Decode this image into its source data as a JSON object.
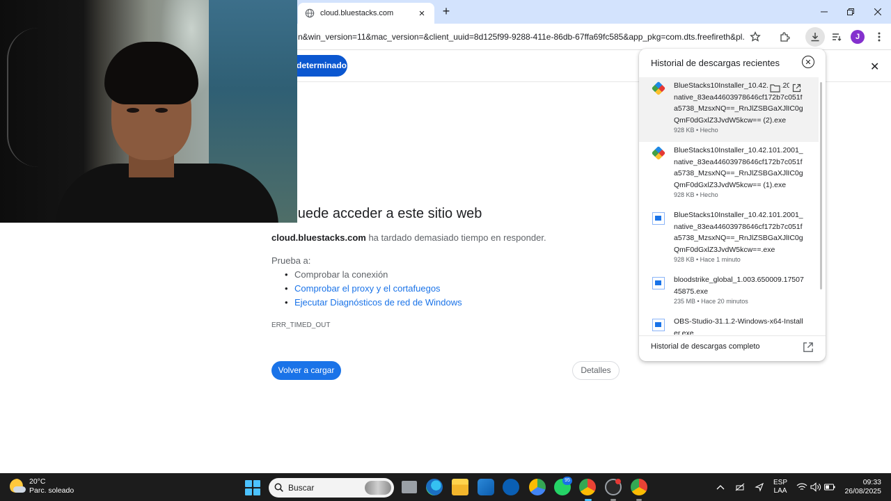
{
  "browser": {
    "tab_title": "cloud.bluestacks.com",
    "url": "n&win_version=11&mac_version=&client_uuid=8d125f99-9288-411e-86db-67ffa69fc585&app_pkg=com.dts.freefireth&pl...",
    "avatar_letter": "J",
    "infobar_button": "determinado"
  },
  "error_page": {
    "title": "se puede acceder a este sitio web",
    "host": "cloud.bluestacks.com",
    "description": " ha tardado demasiado tiempo en responder.",
    "try_label": "Prueba a:",
    "suggestions": [
      "Comprobar la conexión",
      "Comprobar el proxy y el cortafuegos",
      "Ejecutar Diagnósticos de red de Windows"
    ],
    "code": "ERR_TIMED_OUT",
    "reload_label": "Volver a cargar",
    "details_label": "Detalles"
  },
  "downloads": {
    "title": "Historial de descargas recientes",
    "footer": "Historial de descargas completo",
    "items": [
      {
        "name": "BlueStacks10Installer_10.42.101.2001_native_83ea44603978646cf172b7c051fa5738_MzsxNQ==_RnJlZSBGaXJlIC0gQmF0dGxlZ3JvdW5kcw== (2).exe",
        "meta": "928 KB • Hecho",
        "icon": "bluestacks-icon"
      },
      {
        "name": "BlueStacks10Installer_10.42.101.2001_native_83ea44603978646cf172b7c051fa5738_MzsxNQ==_RnJlZSBGaXJlIC0gQmF0dGxlZ3JvdW5kcw== (1).exe",
        "meta": "928 KB • Hecho",
        "icon": "bluestacks-icon"
      },
      {
        "name": "BlueStacks10Installer_10.42.101.2001_native_83ea44603978646cf172b7c051fa5738_MzsxNQ==_RnJlZSBGaXJlIC0gQmF0dGxlZ3JvdW5kcw==.exe",
        "meta": "928 KB • Hace 1 minuto",
        "icon": "exe-file-icon"
      },
      {
        "name": "bloodstrike_global_1.003.650009.1750745875.exe",
        "meta": "235 MB • Hace 20 minutos",
        "icon": "exe-file-icon"
      },
      {
        "name": "OBS-Studio-31.1.2-Windows-x64-Installer.exe",
        "meta": "",
        "icon": "exe-file-icon"
      }
    ]
  },
  "taskbar": {
    "temperature": "20°C",
    "weather": "Parc. soleado",
    "search_placeholder": "Buscar",
    "whatsapp_badge": "95",
    "lang_top": "ESP",
    "lang_bottom": "LAA",
    "time": "09:33",
    "date": "26/08/2025"
  },
  "colors": {
    "accent": "#1a73e8",
    "tabstrip": "#d3e3fd",
    "taskbar": "#1c1c1c"
  }
}
